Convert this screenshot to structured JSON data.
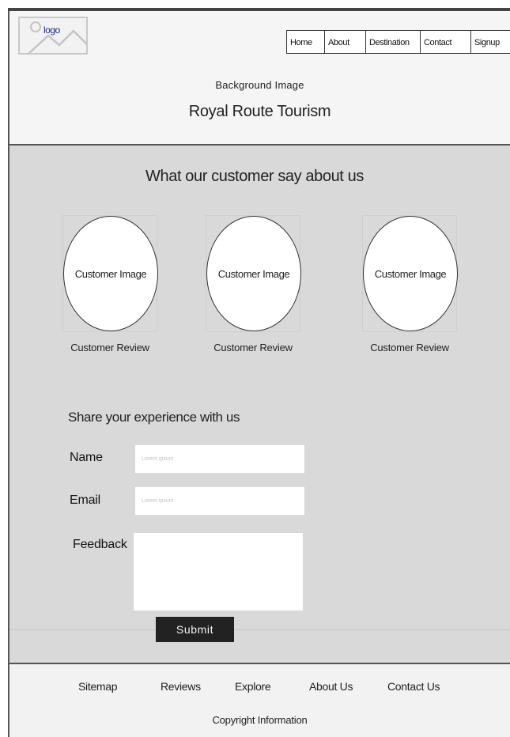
{
  "header": {
    "logo_text": "logo",
    "nav": {
      "home": "Home",
      "about": "About",
      "destination": "Destination",
      "contact": "Contact",
      "signup": "Signup"
    },
    "background_label": "Background Image",
    "site_title": "Royal Route Tourism"
  },
  "testimonials": {
    "title": "What our customer say about us",
    "items": [
      {
        "image_label": "Customer Image",
        "review": "Customer Review"
      },
      {
        "image_label": "Customer Image",
        "review": "Customer Review"
      },
      {
        "image_label": "Customer Image",
        "review": "Customer Review"
      }
    ]
  },
  "feedback_form": {
    "title": "Share your experience with us",
    "name_label": "Name",
    "name_placeholder": "Lorem ipsum",
    "email_label": "Email",
    "email_placeholder": "Lorem ipsum",
    "feedback_label": "Feedback",
    "submit_label": "Submit"
  },
  "footer": {
    "links": [
      "Sitemap",
      "Reviews",
      "Explore",
      "About Us",
      "Contact Us"
    ],
    "copyright": "Copyright Information"
  },
  "colors": {
    "header_bg": "#f5f5f5",
    "main_bg": "#d9d9d9",
    "footer_bg": "#f2f2f2",
    "button_bg": "#222222",
    "logo_text": "#1a2a8a"
  }
}
